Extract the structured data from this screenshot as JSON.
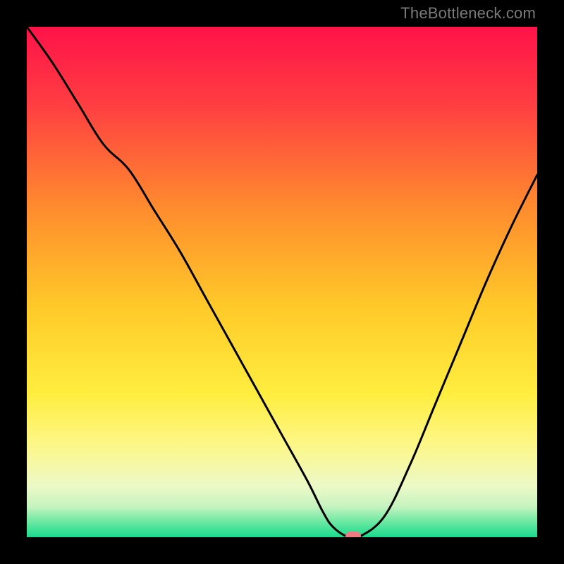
{
  "watermark": "TheBottleneck.com",
  "chart_data": {
    "type": "line",
    "title": "",
    "xlabel": "",
    "ylabel": "",
    "xlim": [
      0,
      100
    ],
    "ylim": [
      0,
      100
    ],
    "gradient_stops": [
      {
        "offset": 0,
        "color": "#ff1249"
      },
      {
        "offset": 15,
        "color": "#ff3d42"
      },
      {
        "offset": 35,
        "color": "#ff8a2e"
      },
      {
        "offset": 55,
        "color": "#ffca29"
      },
      {
        "offset": 72,
        "color": "#ffee3f"
      },
      {
        "offset": 82,
        "color": "#fdf789"
      },
      {
        "offset": 90,
        "color": "#ecf9c7"
      },
      {
        "offset": 94,
        "color": "#c6f3bf"
      },
      {
        "offset": 97,
        "color": "#6be8a2"
      },
      {
        "offset": 100,
        "color": "#18db8d"
      }
    ],
    "series": [
      {
        "name": "bottleneck-curve",
        "x": [
          0,
          5,
          10,
          15,
          20,
          25,
          30,
          35,
          40,
          45,
          50,
          55,
          58,
          60,
          63,
          65,
          70,
          75,
          80,
          85,
          90,
          95,
          100
        ],
        "y": [
          100,
          93,
          85,
          77,
          72,
          64,
          56,
          47,
          38,
          29,
          20,
          11,
          5,
          2,
          0,
          0,
          4,
          14,
          26,
          38,
          50,
          61,
          71
        ]
      }
    ],
    "marker": {
      "x": 64,
      "y": 0
    }
  }
}
